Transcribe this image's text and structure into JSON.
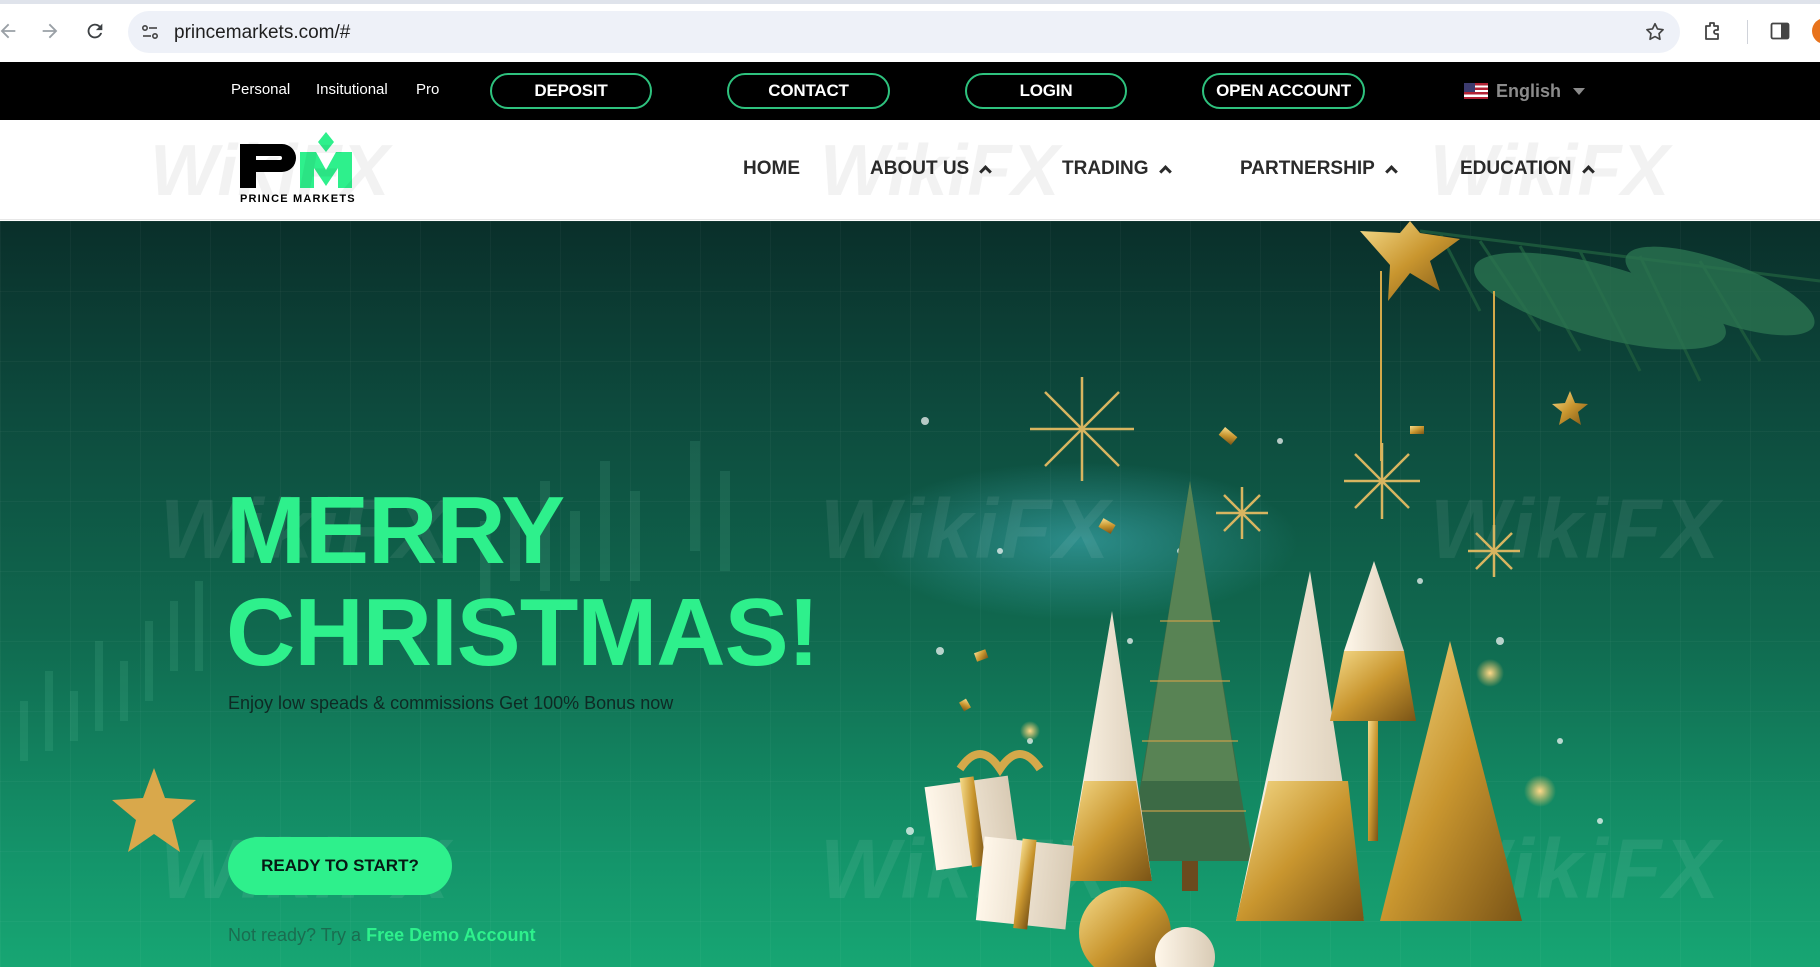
{
  "browser": {
    "url": "princemarkets.com/#"
  },
  "topbar": {
    "segments": [
      "Personal",
      "Insitutional",
      "Pro"
    ],
    "buttons": {
      "deposit": "DEPOSIT",
      "contact": "CONTACT",
      "login": "LOGIN",
      "open_account": "OPEN ACCOUNT"
    },
    "language": "English"
  },
  "brand": {
    "logo_initials": "PM",
    "name": "PRINCE MARKETS",
    "accent_color": "#2ef08c"
  },
  "nav": {
    "items": [
      "HOME",
      "ABOUT US",
      "TRADING",
      "PARTNERSHIP",
      "EDUCATION"
    ]
  },
  "hero": {
    "headline_line1": "MERRY",
    "headline_line2": "CHRISTMAS!",
    "subtitle": "Enjoy low speads & commissions Get 100% Bonus now",
    "cta_label": "READY TO START?",
    "demo_prefix": "Not ready? Try a",
    "demo_link": "Free Demo Account"
  },
  "watermark": "WikiFX"
}
